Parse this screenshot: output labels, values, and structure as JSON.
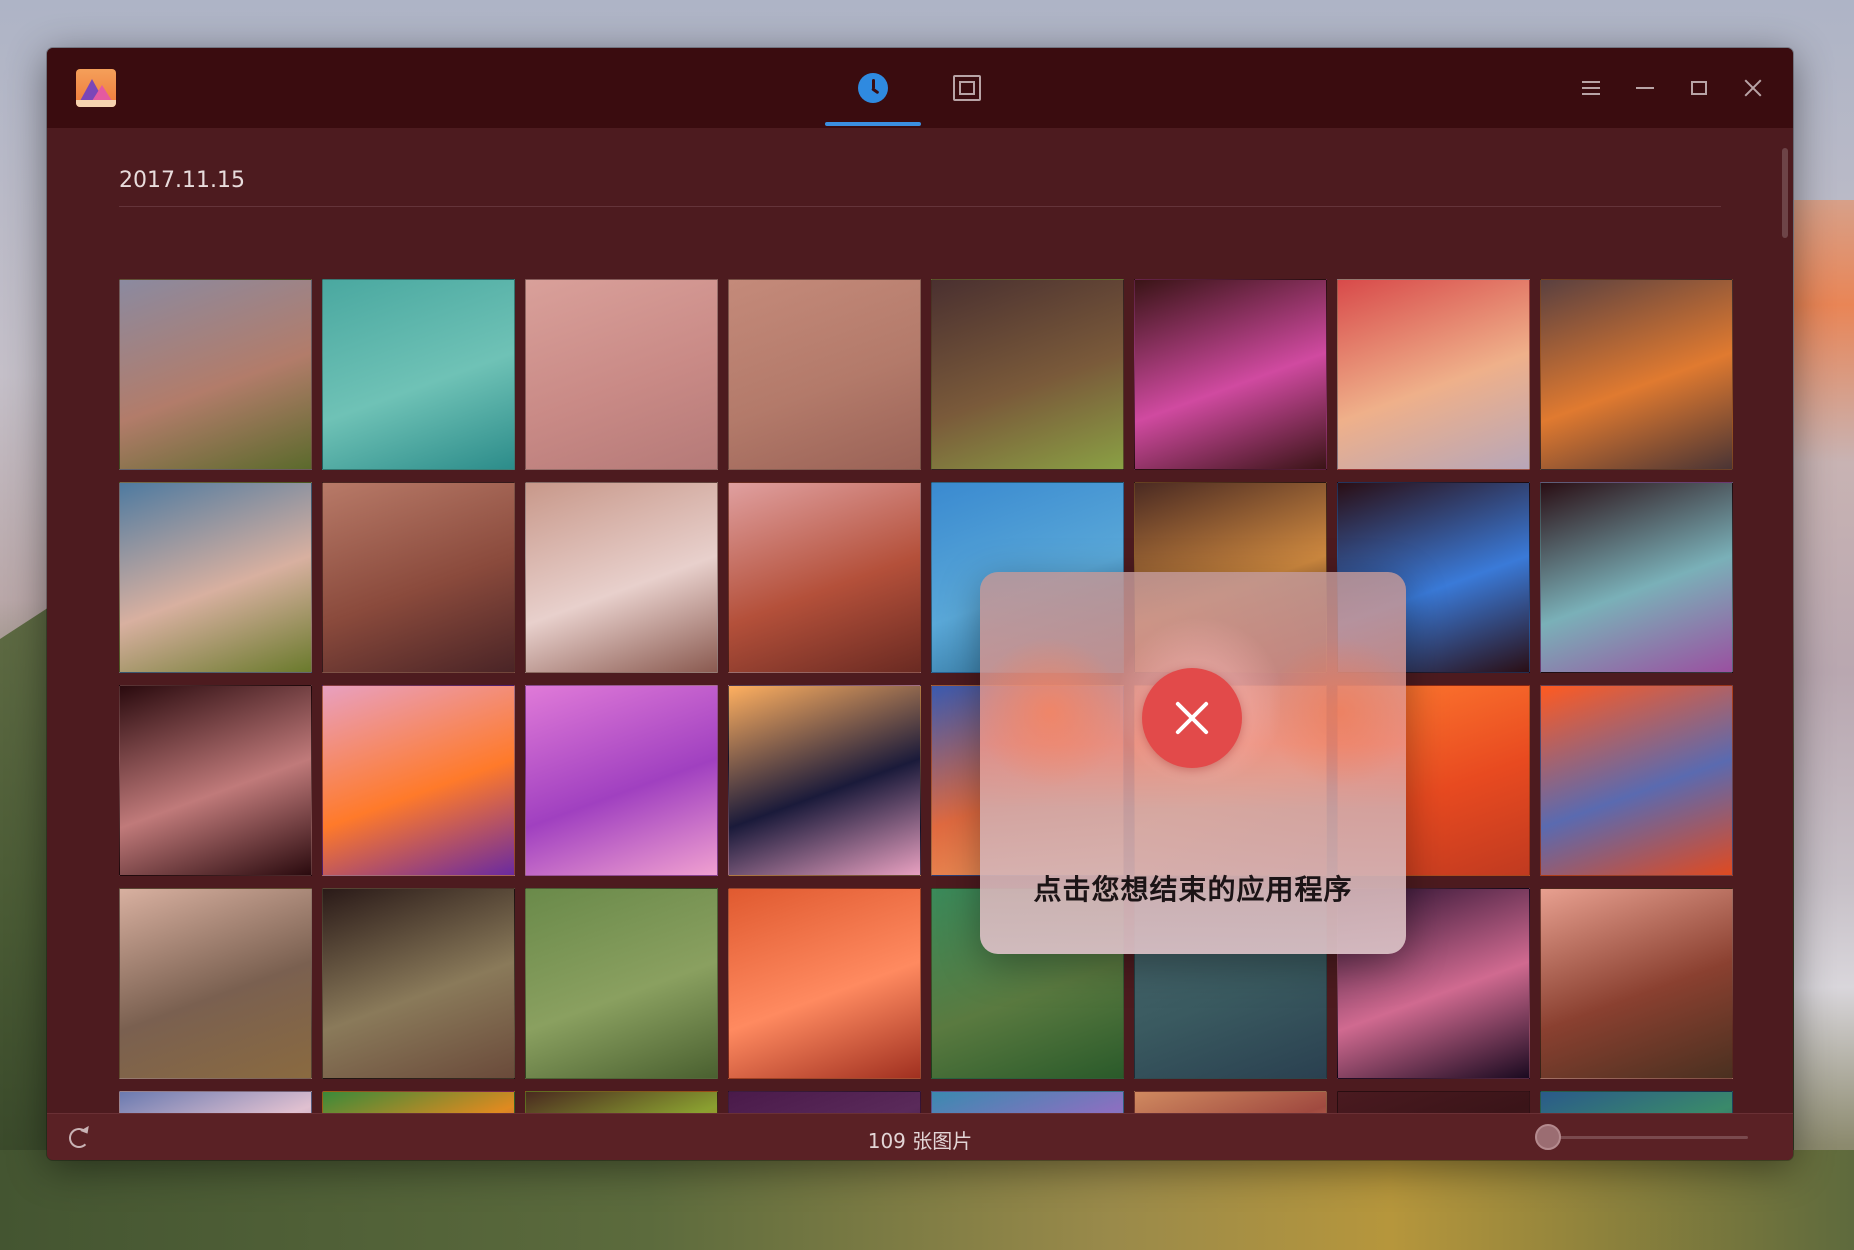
{
  "window": {
    "tabs": [
      {
        "name": "timeline",
        "icon": "clock-icon",
        "active": true
      },
      {
        "name": "albums",
        "icon": "album-icon",
        "active": false
      }
    ],
    "controls": [
      "menu-icon",
      "minimize-icon",
      "maximize-icon",
      "close-icon"
    ]
  },
  "timeline": {
    "date_label": "2017.11.15"
  },
  "thumbnails": [
    {
      "row": 0,
      "col": 0,
      "colors": [
        "#8b8aa0",
        "#b27c6a",
        "#5b6a2c"
      ]
    },
    {
      "row": 0,
      "col": 1,
      "colors": [
        "#4aa8a0",
        "#6fc2b6",
        "#2c8c8a"
      ]
    },
    {
      "row": 0,
      "col": 2,
      "colors": [
        "#d9a09a",
        "#c98a86",
        "#b57a78"
      ]
    },
    {
      "row": 0,
      "col": 3,
      "colors": [
        "#c48a7a",
        "#b37a6a",
        "#9a6256"
      ]
    },
    {
      "row": 0,
      "col": 4,
      "colors": [
        "#4a3030",
        "#7a5a3a",
        "#8aa044"
      ]
    },
    {
      "row": 0,
      "col": 5,
      "colors": [
        "#3a1416",
        "#d04aa0",
        "#3a1416"
      ]
    },
    {
      "row": 0,
      "col": 6,
      "colors": [
        "#d84a4a",
        "#efb08a",
        "#b7a6b8"
      ]
    },
    {
      "row": 0,
      "col": 7,
      "colors": [
        "#5a4040",
        "#e07a30",
        "#4a3434"
      ]
    },
    {
      "row": 1,
      "col": 0,
      "colors": [
        "#4e7aa0",
        "#d8b0a0",
        "#6a7a2c"
      ]
    },
    {
      "row": 1,
      "col": 1,
      "colors": [
        "#b87a68",
        "#8a4a3c",
        "#4a2426"
      ]
    },
    {
      "row": 1,
      "col": 2,
      "colors": [
        "#c8988a",
        "#e8d0cc",
        "#8a5a50"
      ]
    },
    {
      "row": 1,
      "col": 3,
      "colors": [
        "#e0a0a0",
        "#b4503a",
        "#6a2a22"
      ]
    },
    {
      "row": 1,
      "col": 4,
      "colors": [
        "#3a8ad0",
        "#5aa8d8",
        "#2a6a90"
      ]
    },
    {
      "row": 1,
      "col": 5,
      "colors": [
        "#4a2a22",
        "#d08a40",
        "#3a1e1a"
      ]
    },
    {
      "row": 1,
      "col": 6,
      "colors": [
        "#2a0e14",
        "#3a7ad8",
        "#2a0e14"
      ]
    },
    {
      "row": 1,
      "col": 7,
      "colors": [
        "#2a0e14",
        "#7ab0b8",
        "#9a50a0"
      ]
    },
    {
      "row": 2,
      "col": 0,
      "colors": [
        "#2a0a0e",
        "#c07a7a",
        "#2a0a0e"
      ]
    },
    {
      "row": 2,
      "col": 1,
      "colors": [
        "#e8a0c0",
        "#ff7a2a",
        "#6a2aa0"
      ]
    },
    {
      "row": 2,
      "col": 2,
      "colors": [
        "#e07ad8",
        "#a040c0",
        "#f0a0d0"
      ]
    },
    {
      "row": 2,
      "col": 3,
      "colors": [
        "#ffb060",
        "#1a1a3a",
        "#e8a0c0"
      ]
    },
    {
      "row": 2,
      "col": 4,
      "colors": [
        "#3a5ab0",
        "#e06a40",
        "#f0a060"
      ]
    },
    {
      "row": 2,
      "col": 5,
      "colors": [
        "#e06a40",
        "#ff8a40",
        "#c04020"
      ]
    },
    {
      "row": 2,
      "col": 6,
      "colors": [
        "#ff7a30",
        "#e84a20",
        "#c03a20"
      ]
    },
    {
      "row": 2,
      "col": 7,
      "colors": [
        "#ff5a20",
        "#5a6ab0",
        "#e04a20"
      ]
    },
    {
      "row": 3,
      "col": 0,
      "colors": [
        "#d8b0a0",
        "#7a6050",
        "#8a6a40"
      ]
    },
    {
      "row": 3,
      "col": 1,
      "colors": [
        "#2a1a18",
        "#8a7a5a",
        "#6a4a3a"
      ]
    },
    {
      "row": 3,
      "col": 2,
      "colors": [
        "#6a8a4a",
        "#8aa060",
        "#4a6030"
      ]
    },
    {
      "row": 3,
      "col": 3,
      "colors": [
        "#e05a30",
        "#ff8a60",
        "#a03020"
      ]
    },
    {
      "row": 3,
      "col": 4,
      "colors": [
        "#3a8a5a",
        "#5a7a40",
        "#2a5a2a"
      ]
    },
    {
      "row": 3,
      "col": 5,
      "colors": [
        "#4a6a70",
        "#3a5a60",
        "#2a4050"
      ]
    },
    {
      "row": 3,
      "col": 6,
      "colors": [
        "#2a1030",
        "#d06a90",
        "#1a0a20"
      ]
    },
    {
      "row": 3,
      "col": 7,
      "colors": [
        "#e8a090",
        "#8a4030",
        "#4a3020"
      ]
    },
    {
      "row": 4,
      "col": 0,
      "colors": [
        "#6a7ab0",
        "#e0c0d0",
        "#9a80a0"
      ]
    },
    {
      "row": 4,
      "col": 1,
      "colors": [
        "#3a8a3a",
        "#e08a20",
        "#a02a70"
      ]
    },
    {
      "row": 4,
      "col": 2,
      "colors": [
        "#4a2a20",
        "#8aa030",
        "#e06a20"
      ]
    },
    {
      "row": 4,
      "col": 3,
      "colors": [
        "#4a1a4a",
        "#5a2a5a",
        "#3a1a3a"
      ]
    },
    {
      "row": 4,
      "col": 4,
      "colors": [
        "#3a8ab0",
        "#8a70c0",
        "#50a0c0"
      ]
    },
    {
      "row": 4,
      "col": 5,
      "colors": [
        "#d08a60",
        "#a04a40",
        "#e0a070"
      ]
    },
    {
      "row": 4,
      "col": 6,
      "colors": [
        "#4a1a20",
        "#3a1418",
        "#4a1a20"
      ]
    },
    {
      "row": 4,
      "col": 7,
      "colors": [
        "#2a5a8a",
        "#3a8a6a",
        "#2a3a6a"
      ]
    }
  ],
  "dialog": {
    "message": "点击您想结束的应用程序",
    "close_icon": "close-circle-icon",
    "accent": "#e24a4a"
  },
  "status": {
    "count_text": "109 张图片",
    "import_icon": "import-icon",
    "zoom_level": 0
  }
}
